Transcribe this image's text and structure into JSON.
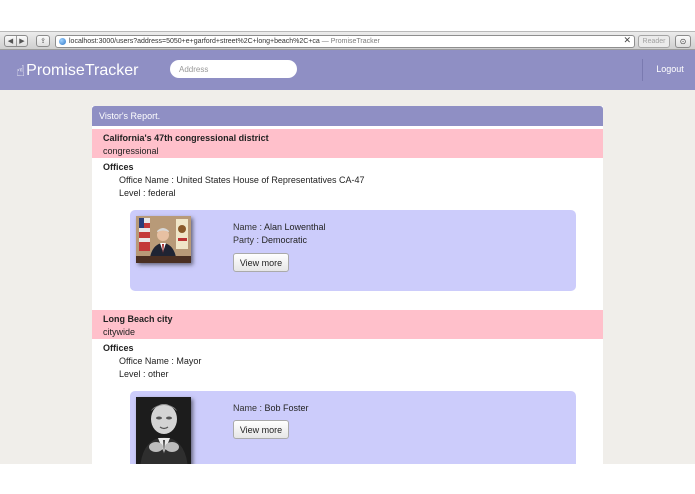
{
  "browser": {
    "url": "localhost:3000/users?address=5050+e+garford+street%2C+long+beach%2C+ca",
    "page_title_suffix": " — PromiseTracker",
    "reader_label": "Reader",
    "back_icon": "◀",
    "forward_icon": "▶",
    "share_icon": "⇪",
    "stop_icon": "✕",
    "download_icon": "⊙"
  },
  "navbar": {
    "brand_icon": "☝",
    "brand": "PromiseTracker",
    "search_placeholder": "Address",
    "logout_label": "Logout",
    "color": "#8f8fc4"
  },
  "report": {
    "title": "Vistor's Report.",
    "districts": [
      {
        "name": "California's 47th congressional district",
        "type": "congressional",
        "offices_label": "Offices",
        "office_name_label": "Office Name : ",
        "office_name": "United States House of Representatives CA-47",
        "level_label": "Level : ",
        "level": "federal",
        "rep": {
          "name_label": "Name : ",
          "name": "Alan Lowenthal",
          "party_label": "Party : ",
          "party": "Democratic",
          "button_label": "View more"
        }
      },
      {
        "name": "Long Beach city",
        "type": "citywide",
        "offices_label": "Offices",
        "office_name_label": "Office Name : ",
        "office_name": "Mayor",
        "level_label": "Level : ",
        "level": "other",
        "rep": {
          "name_label": "Name : ",
          "name": "Bob Foster",
          "button_label": "View more"
        }
      }
    ]
  },
  "colors": {
    "district_header": "#ffc0cb",
    "rep_card": "#ccccfb",
    "page_bg": "#f0eeea"
  }
}
